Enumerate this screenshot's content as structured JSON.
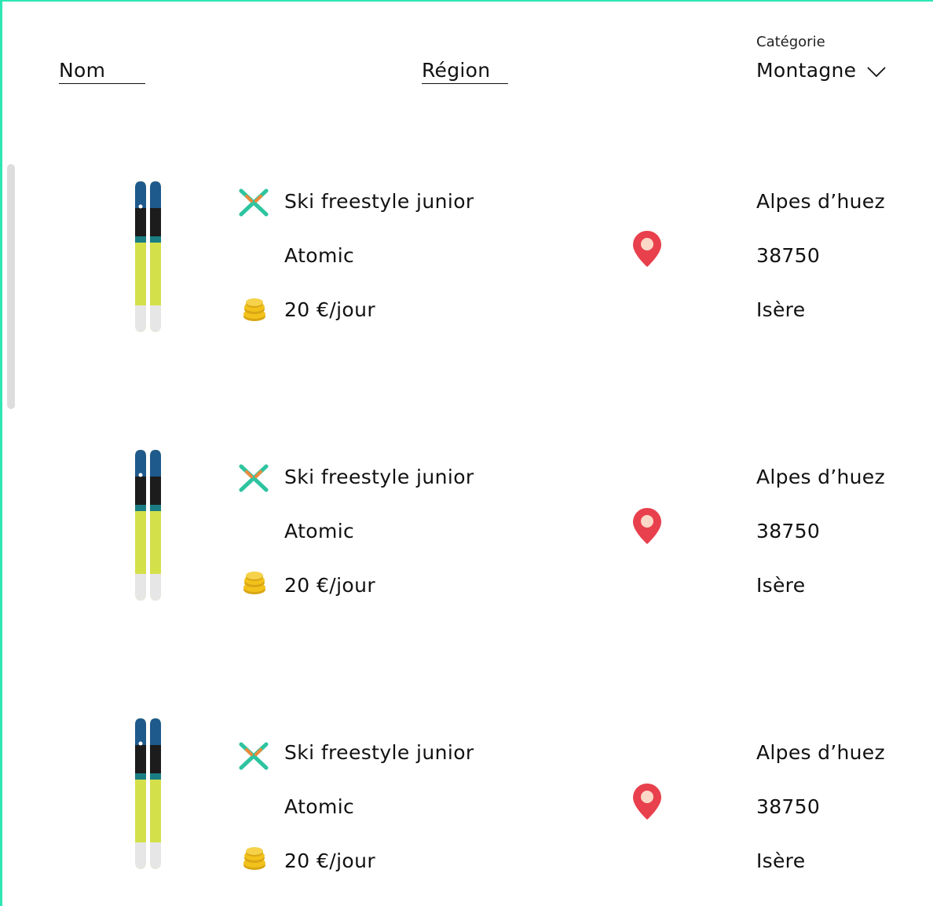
{
  "filters": {
    "name_label": "Nom",
    "region_label": "Région",
    "category_label": "Catégorie",
    "category_value": "Montagne"
  },
  "colors": {
    "accent_frame": "#2de6b4",
    "pin": "#e8404c",
    "coin": "#f2c21b",
    "ski_blue": "#1f5a8c",
    "ski_yellow": "#d4e04a"
  },
  "listings": [
    {
      "title": "Ski freestyle junior",
      "brand": "Atomic",
      "price": "20 €/jour",
      "city": "Alpes d’huez",
      "postal_code": "38750",
      "department": "Isère"
    },
    {
      "title": "Ski freestyle junior",
      "brand": "Atomic",
      "price": "20 €/jour",
      "city": "Alpes d’huez",
      "postal_code": "38750",
      "department": "Isère"
    },
    {
      "title": "Ski freestyle junior",
      "brand": "Atomic",
      "price": "20 €/jour",
      "city": "Alpes d’huez",
      "postal_code": "38750",
      "department": "Isère"
    }
  ]
}
